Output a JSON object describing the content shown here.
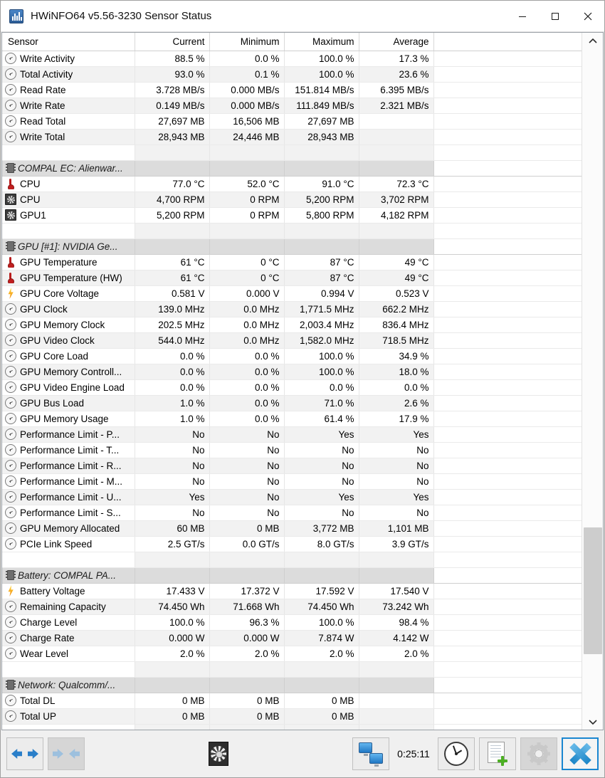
{
  "window": {
    "title": "HWiNFO64 v5.56-3230 Sensor Status",
    "icon": "hwinfo-app-icon",
    "minimize_label": "–",
    "maximize_label": "☐",
    "close_label": "✕"
  },
  "columns": [
    "Sensor",
    "Current",
    "Minimum",
    "Maximum",
    "Average"
  ],
  "rows": [
    {
      "kind": "data",
      "icon": "gauge",
      "name": "Write Activity",
      "current": "88.5 %",
      "minimum": "0.0 %",
      "maximum": "100.0 %",
      "average": "17.3 %"
    },
    {
      "kind": "data",
      "icon": "gauge",
      "name": "Total Activity",
      "current": "93.0 %",
      "minimum": "0.1 %",
      "maximum": "100.0 %",
      "average": "23.6 %"
    },
    {
      "kind": "data",
      "icon": "gauge",
      "name": "Read Rate",
      "current": "3.728 MB/s",
      "minimum": "0.000 MB/s",
      "maximum": "151.814 MB/s",
      "average": "6.395 MB/s"
    },
    {
      "kind": "data",
      "icon": "gauge",
      "name": "Write Rate",
      "current": "0.149 MB/s",
      "minimum": "0.000 MB/s",
      "maximum": "111.849 MB/s",
      "average": "2.321 MB/s"
    },
    {
      "kind": "data",
      "icon": "gauge",
      "name": "Read Total",
      "current": "27,697 MB",
      "minimum": "16,506 MB",
      "maximum": "27,697 MB",
      "average": ""
    },
    {
      "kind": "data",
      "icon": "gauge",
      "name": "Write Total",
      "current": "28,943 MB",
      "minimum": "24,446 MB",
      "maximum": "28,943 MB",
      "average": ""
    },
    {
      "kind": "spacer"
    },
    {
      "kind": "section",
      "icon": "chip",
      "name": "COMPAL EC: Alienwar..."
    },
    {
      "kind": "data",
      "icon": "temp",
      "name": "CPU",
      "current": "77.0 °C",
      "minimum": "52.0 °C",
      "maximum": "91.0 °C",
      "average": "72.3 °C"
    },
    {
      "kind": "data",
      "icon": "fan",
      "name": "CPU",
      "current": "4,700 RPM",
      "minimum": "0 RPM",
      "maximum": "5,200 RPM",
      "average": "3,702 RPM"
    },
    {
      "kind": "data",
      "icon": "fan",
      "name": "GPU1",
      "current": "5,200 RPM",
      "minimum": "0 RPM",
      "maximum": "5,800 RPM",
      "average": "4,182 RPM"
    },
    {
      "kind": "spacer"
    },
    {
      "kind": "section",
      "icon": "chip",
      "name": "GPU [#1]: NVIDIA Ge..."
    },
    {
      "kind": "data",
      "icon": "temp",
      "name": "GPU Temperature",
      "current": "61 °C",
      "minimum": "0 °C",
      "maximum": "87 °C",
      "average": "49 °C"
    },
    {
      "kind": "data",
      "icon": "temp",
      "name": "GPU Temperature (HW)",
      "current": "61 °C",
      "minimum": "0 °C",
      "maximum": "87 °C",
      "average": "49 °C"
    },
    {
      "kind": "data",
      "icon": "volt",
      "name": "GPU Core Voltage",
      "current": "0.581 V",
      "minimum": "0.000 V",
      "maximum": "0.994 V",
      "average": "0.523 V"
    },
    {
      "kind": "data",
      "icon": "gauge",
      "name": "GPU Clock",
      "current": "139.0 MHz",
      "minimum": "0.0 MHz",
      "maximum": "1,771.5 MHz",
      "average": "662.2 MHz"
    },
    {
      "kind": "data",
      "icon": "gauge",
      "name": "GPU Memory Clock",
      "current": "202.5 MHz",
      "minimum": "0.0 MHz",
      "maximum": "2,003.4 MHz",
      "average": "836.4 MHz"
    },
    {
      "kind": "data",
      "icon": "gauge",
      "name": "GPU Video Clock",
      "current": "544.0 MHz",
      "minimum": "0.0 MHz",
      "maximum": "1,582.0 MHz",
      "average": "718.5 MHz"
    },
    {
      "kind": "data",
      "icon": "gauge",
      "name": "GPU Core Load",
      "current": "0.0 %",
      "minimum": "0.0 %",
      "maximum": "100.0 %",
      "average": "34.9 %"
    },
    {
      "kind": "data",
      "icon": "gauge",
      "name": "GPU Memory Controll...",
      "current": "0.0 %",
      "minimum": "0.0 %",
      "maximum": "100.0 %",
      "average": "18.0 %"
    },
    {
      "kind": "data",
      "icon": "gauge",
      "name": "GPU Video Engine Load",
      "current": "0.0 %",
      "minimum": "0.0 %",
      "maximum": "0.0 %",
      "average": "0.0 %"
    },
    {
      "kind": "data",
      "icon": "gauge",
      "name": "GPU Bus Load",
      "current": "1.0 %",
      "minimum": "0.0 %",
      "maximum": "71.0 %",
      "average": "2.6 %"
    },
    {
      "kind": "data",
      "icon": "gauge",
      "name": "GPU Memory Usage",
      "current": "1.0 %",
      "minimum": "0.0 %",
      "maximum": "61.4 %",
      "average": "17.9 %"
    },
    {
      "kind": "data",
      "icon": "gauge",
      "name": "Performance Limit - P...",
      "current": "No",
      "minimum": "No",
      "maximum": "Yes",
      "average": "Yes"
    },
    {
      "kind": "data",
      "icon": "gauge",
      "name": "Performance Limit - T...",
      "current": "No",
      "minimum": "No",
      "maximum": "No",
      "average": "No"
    },
    {
      "kind": "data",
      "icon": "gauge",
      "name": "Performance Limit - R...",
      "current": "No",
      "minimum": "No",
      "maximum": "No",
      "average": "No"
    },
    {
      "kind": "data",
      "icon": "gauge",
      "name": "Performance Limit - M...",
      "current": "No",
      "minimum": "No",
      "maximum": "No",
      "average": "No"
    },
    {
      "kind": "data",
      "icon": "gauge",
      "name": "Performance Limit - U...",
      "current": "Yes",
      "minimum": "No",
      "maximum": "Yes",
      "average": "Yes"
    },
    {
      "kind": "data",
      "icon": "gauge",
      "name": "Performance Limit - S...",
      "current": "No",
      "minimum": "No",
      "maximum": "No",
      "average": "No"
    },
    {
      "kind": "data",
      "icon": "gauge",
      "name": "GPU Memory Allocated",
      "current": "60 MB",
      "minimum": "0 MB",
      "maximum": "3,772 MB",
      "average": "1,101 MB"
    },
    {
      "kind": "data",
      "icon": "gauge",
      "name": "PCIe Link Speed",
      "current": "2.5 GT/s",
      "minimum": "0.0 GT/s",
      "maximum": "8.0 GT/s",
      "average": "3.9 GT/s"
    },
    {
      "kind": "spacer"
    },
    {
      "kind": "section",
      "icon": "chip",
      "name": "Battery: COMPAL  PA..."
    },
    {
      "kind": "data",
      "icon": "volt",
      "name": "Battery Voltage",
      "current": "17.433 V",
      "minimum": "17.372 V",
      "maximum": "17.592 V",
      "average": "17.540 V"
    },
    {
      "kind": "data",
      "icon": "gauge",
      "name": "Remaining Capacity",
      "current": "74.450 Wh",
      "minimum": "71.668 Wh",
      "maximum": "74.450 Wh",
      "average": "73.242 Wh"
    },
    {
      "kind": "data",
      "icon": "gauge",
      "name": "Charge Level",
      "current": "100.0 %",
      "minimum": "96.3 %",
      "maximum": "100.0 %",
      "average": "98.4 %"
    },
    {
      "kind": "data",
      "icon": "gauge",
      "name": "Charge Rate",
      "current": "0.000 W",
      "minimum": "0.000 W",
      "maximum": "7.874 W",
      "average": "4.142 W"
    },
    {
      "kind": "data",
      "icon": "gauge",
      "name": "Wear Level",
      "current": "2.0 %",
      "minimum": "2.0 %",
      "maximum": "2.0 %",
      "average": "2.0 %"
    },
    {
      "kind": "spacer"
    },
    {
      "kind": "section",
      "icon": "chip",
      "name": "Network: Qualcomm/..."
    },
    {
      "kind": "data",
      "icon": "gauge",
      "name": "Total DL",
      "current": "0 MB",
      "minimum": "0 MB",
      "maximum": "0 MB",
      "average": ""
    },
    {
      "kind": "data",
      "icon": "gauge",
      "name": "Total UP",
      "current": "0 MB",
      "minimum": "0 MB",
      "maximum": "0 MB",
      "average": ""
    },
    {
      "kind": "spacer"
    }
  ],
  "scrollbar": {
    "up_arrow": "⌃",
    "down_arrow": "⌄",
    "thumb_top_pct": 72,
    "thumb_height_pct": 19
  },
  "toolbar": {
    "expand_all_label": "expand-all",
    "collapse_all_label": "collapse-all",
    "fan_label": "fan-control",
    "remote_label": "remote-monitoring",
    "timer": "0:25:11",
    "clock_label": "logging-interval",
    "log_label": "start-logging",
    "settings_label": "sensor-settings",
    "close_label": "close"
  },
  "colors": {
    "accent": "#1c86c8",
    "section_header_bg": "#dcdcdc",
    "alt_row_bg": "#f2f2f2",
    "temp_icon": "#c01f1f",
    "volt_icon": "#f0a818"
  }
}
